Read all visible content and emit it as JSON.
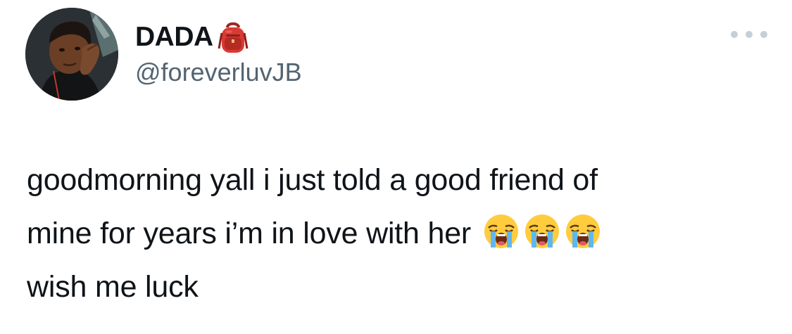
{
  "author": {
    "display_name": "DADA",
    "name_emoji": "backpack-icon",
    "handle": "@foreverluvJB"
  },
  "tweet": {
    "line1": "goodmorning yall i just told a good friend of",
    "line2": "mine for years i’m in love with her",
    "line3": "wish me luck",
    "emoji": "loudly-crying-face-icon"
  },
  "colors": {
    "text": "#0f1419",
    "secondary": "#536471",
    "more_dots": "#c4cfd6"
  }
}
